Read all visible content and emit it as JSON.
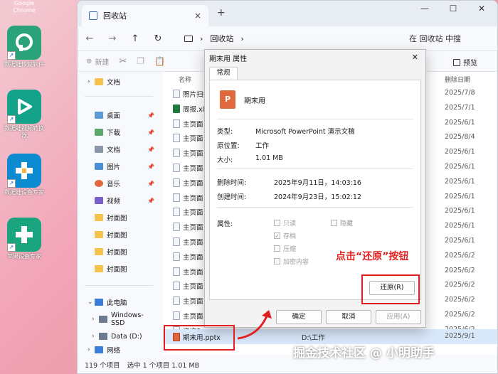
{
  "desktop": {
    "top_label": "Google Chrome",
    "icons": [
      {
        "caption": "数据蛙恢复软件",
        "color": "#2aa37a"
      },
      {
        "caption": "数据蛙视频转换器",
        "color": "#14a38a"
      },
      {
        "caption": "数据蛙设备专家",
        "color": "#0d8bd0"
      },
      {
        "caption": "苹果设备专家",
        "color": "#1aa57e"
      }
    ]
  },
  "window": {
    "tab_title": "回收站",
    "tab_close": "×",
    "new_tab": "+",
    "controls": {
      "minimize": "—",
      "maximize": "☐",
      "close": "✕"
    }
  },
  "nav": {
    "back": "←",
    "forward": "→",
    "up": "↑",
    "refresh": "↻",
    "path_sep": "›",
    "path": "回收站",
    "search_placeholder": "在 回收站 中搜"
  },
  "toolbar": {
    "new_label": "新建",
    "preview_label": "预览"
  },
  "sidebar": {
    "items": [
      {
        "label": "文档",
        "type": "folder",
        "expander": "›",
        "pin": ""
      },
      {
        "label": "桌面",
        "type": "sys",
        "expander": "",
        "pin": "📌"
      },
      {
        "label": "下载",
        "type": "sys",
        "expander": "",
        "pin": "📌"
      },
      {
        "label": "文档",
        "type": "sys",
        "expander": "",
        "pin": "📌"
      },
      {
        "label": "图片",
        "type": "sys",
        "expander": "",
        "pin": "📌"
      },
      {
        "label": "音乐",
        "type": "sys",
        "expander": "",
        "pin": "📌"
      },
      {
        "label": "视频",
        "type": "sys",
        "expander": "",
        "pin": "📌"
      },
      {
        "label": "封面图",
        "type": "folder",
        "expander": "",
        "pin": ""
      },
      {
        "label": "封面图",
        "type": "folder",
        "expander": "",
        "pin": ""
      },
      {
        "label": "封面图",
        "type": "folder",
        "expander": "",
        "pin": ""
      },
      {
        "label": "封面图",
        "type": "folder",
        "expander": "",
        "pin": ""
      },
      {
        "label": "此电脑",
        "type": "sys",
        "expander": "⌄",
        "pin": ""
      },
      {
        "label": "Windows-SSD",
        "type": "sys",
        "expander": "›",
        "pin": ""
      },
      {
        "label": "Data (D:)",
        "type": "sys",
        "expander": "›",
        "pin": ""
      },
      {
        "label": "网络",
        "type": "sys",
        "expander": "›",
        "pin": ""
      }
    ]
  },
  "filelist": {
    "headers": {
      "name": "名称",
      "date": "删除日期"
    },
    "rows": [
      {
        "name": "照片扫描",
        "mid": "",
        "date": "2025/7/8",
        "icon": "doc"
      },
      {
        "name": "周报.xlsx",
        "mid": "",
        "date": "2025/7/1",
        "icon": "xls"
      },
      {
        "name": "主页面",
        "mid": "",
        "date": "2025/6/1",
        "icon": "doc"
      },
      {
        "name": "主页面",
        "mid": "",
        "date": "2025/8/4",
        "icon": "doc"
      },
      {
        "name": "主页面",
        "mid": "",
        "date": "2025/6/1",
        "icon": "doc"
      },
      {
        "name": "主页面",
        "mid": "",
        "date": "2025/6/1",
        "icon": "doc"
      },
      {
        "name": "主页面",
        "mid": "",
        "date": "2025/6/1",
        "icon": "doc"
      },
      {
        "name": "主页面",
        "mid": "",
        "date": "2025/6/1",
        "icon": "doc"
      },
      {
        "name": "主页面",
        "mid": "",
        "date": "2025/6/1",
        "icon": "doc"
      },
      {
        "name": "主页面",
        "mid": "",
        "date": "2025/6/1",
        "icon": "doc"
      },
      {
        "name": "主页面",
        "mid": "",
        "date": "2025/6/1",
        "icon": "doc"
      },
      {
        "name": "主页面",
        "mid": "",
        "date": "2025/6/2",
        "icon": "doc"
      },
      {
        "name": "主页面",
        "mid": "",
        "date": "2025/6/2",
        "icon": "doc"
      },
      {
        "name": "主页面",
        "mid": "",
        "date": "2025/6/2",
        "icon": "doc"
      },
      {
        "name": "主页面",
        "mid": "",
        "date": "2025/6/2",
        "icon": "doc"
      },
      {
        "name": "主页面",
        "mid": "",
        "date": "2025/6/2",
        "icon": "doc"
      },
      {
        "name": "咨询8.p",
        "mid": "",
        "date": "2025/6/2",
        "icon": "doc"
      }
    ],
    "selected_row": {
      "name": "期末用.pptx",
      "location": "D:\\工作",
      "date": "2025/9/1"
    }
  },
  "status": {
    "total": "119 个项目",
    "selected": "选中 1 个项目  1.01 MB"
  },
  "dialog": {
    "title": "期末用 属性",
    "close": "✕",
    "tab": "常规",
    "ppt_glyph": "P",
    "file_name": "期末用",
    "type_label": "类型:",
    "type_value": "Microsoft PowerPoint 演示文稿",
    "origin_label": "原位置:",
    "origin_value": "工作",
    "size_label": "大小:",
    "size_value": "1.01 MB",
    "deleted_label": "删除时间:",
    "deleted_value": "2025年9月11日，14:03:16",
    "created_label": "创建时间:",
    "created_value": "2024年9月23日，15:02:12",
    "attr_label": "属性:",
    "attrs": {
      "readonly": "只读",
      "hidden": "隐藏",
      "archive": "存档",
      "compress": "压缩",
      "encrypt": "加密内容"
    },
    "restore": "还原(R)",
    "ok": "确定",
    "cancel": "取消",
    "apply": "应用(A)"
  },
  "annotation": {
    "instruction": "点击“还原”按钮"
  },
  "watermark": "掘金技术社区 @ 小明助手"
}
